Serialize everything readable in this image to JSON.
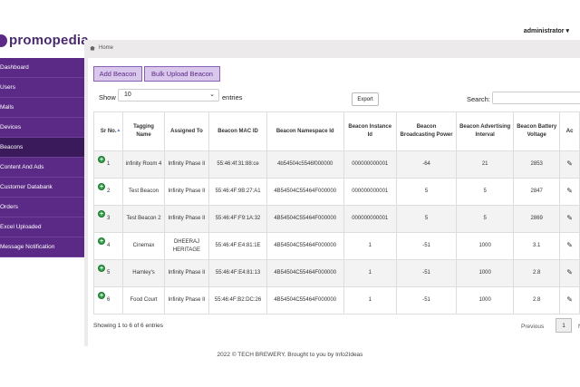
{
  "brand": {
    "name": "promopedia"
  },
  "header": {
    "user": "administrator ▾"
  },
  "breadcrumb": {
    "home": "Home"
  },
  "sidebar": {
    "items": [
      {
        "label": "Dashboard"
      },
      {
        "label": "Users"
      },
      {
        "label": "Malls"
      },
      {
        "label": "Devices"
      },
      {
        "label": "Beacons",
        "active": true
      },
      {
        "label": "Content And Ads"
      },
      {
        "label": "Customer Databank"
      },
      {
        "label": "Orders"
      },
      {
        "label": "Excel Uploaded"
      },
      {
        "label": "Message Notification"
      }
    ]
  },
  "toolbar": {
    "add_label": "Add Beacon",
    "bulk_label": "Bulk Upload Beacon",
    "show_label": "Show",
    "show_value": "10",
    "entries_label": "entries",
    "export_label": "Export",
    "search_label": "Search:"
  },
  "table": {
    "headers": [
      "Sr No.",
      "Tagging Name",
      "Assigned To",
      "Beacon MAC ID",
      "Beacon Namespace Id",
      "Beacon Instance Id",
      "Beacon Broadcasting Power",
      "Beacon Advertising Interval",
      "Beacon Battery Voltage",
      "Ac"
    ],
    "rows": [
      {
        "sr": "1",
        "name": "infinity Room 4",
        "assigned": "Infinity Phase II",
        "mac": "55:46:4f:31:88:ce",
        "namespace": "4b54504c5546f000000",
        "instance": "000000000001",
        "power": "-64",
        "interval": "21",
        "voltage": "2853"
      },
      {
        "sr": "2",
        "name": "Test Beacon",
        "assigned": "Infinity Phase II",
        "mac": "55:46:4F:9B:27:A1",
        "namespace": "4B54504C55464F000000",
        "instance": "000000000001",
        "power": "5",
        "interval": "5",
        "voltage": "2847"
      },
      {
        "sr": "3",
        "name": "Test Beacon 2",
        "assigned": "Infinity Phase II",
        "mac": "55:46:4F:F9:1A:32",
        "namespace": "4B54504C55464F000000",
        "instance": "000000000001",
        "power": "5",
        "interval": "5",
        "voltage": "2869"
      },
      {
        "sr": "4",
        "name": "Cinemax",
        "assigned": "DHEERAJ HERITAGE",
        "mac": "55:46:4F:E4:81:1E",
        "namespace": "4B54504C55464F000000",
        "instance": "1",
        "power": "-51",
        "interval": "1000",
        "voltage": "3.1"
      },
      {
        "sr": "5",
        "name": "Hamley's",
        "assigned": "Infinity Phase II",
        "mac": "55:46:4F:E4:81:13",
        "namespace": "4B54504C55464F000000",
        "instance": "1",
        "power": "-51",
        "interval": "1000",
        "voltage": "2.8"
      },
      {
        "sr": "6",
        "name": "Food Court",
        "assigned": "Infinity Phase II",
        "mac": "55:46:4F:B2:DC:26",
        "namespace": "4B54504C55464F000000",
        "instance": "1",
        "power": "-51",
        "interval": "1000",
        "voltage": "2.8"
      }
    ]
  },
  "pagination": {
    "info": "Showing 1 to 6 of 6 entries",
    "prev": "Previous",
    "page": "1",
    "next": "N"
  },
  "footer": {
    "text": "2022 © TECH BREWERY. Brought to you by Info2Ideas"
  }
}
